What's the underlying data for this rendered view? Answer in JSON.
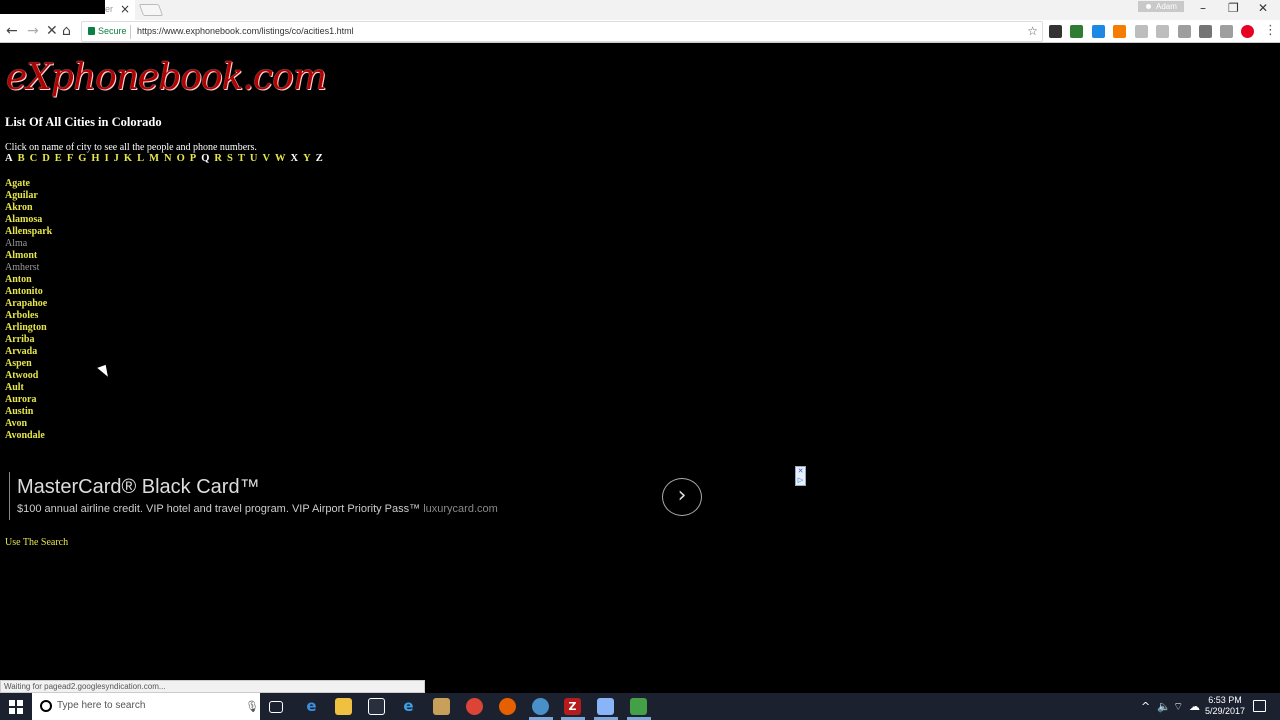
{
  "browser": {
    "tab_title": "er",
    "profile_name": "Adam",
    "secure_label": "Secure",
    "url": "https://www.exphonebook.com/listings/co/acities1.html",
    "status_text": "Waiting for pagead2.googlesyndication.com..."
  },
  "page": {
    "logo": "eXphonebook.com",
    "title": "List Of All Cities in Colorado",
    "instruction": "Click on name of city to see all the people and phone numbers.",
    "letters": [
      "A",
      "B",
      "C",
      "D",
      "E",
      "F",
      "G",
      "H",
      "I",
      "J",
      "K",
      "L",
      "M",
      "N",
      "O",
      "P",
      "Q",
      "R",
      "S",
      "T",
      "U",
      "V",
      "W",
      "X",
      "Y",
      "Z"
    ],
    "current_letter": "A",
    "white_letters": [
      "Q",
      "X",
      "Z"
    ],
    "cities": [
      {
        "name": "Agate",
        "visited": false
      },
      {
        "name": "Aguilar",
        "visited": false
      },
      {
        "name": "Akron",
        "visited": false
      },
      {
        "name": "Alamosa",
        "visited": false
      },
      {
        "name": "Allenspark",
        "visited": false
      },
      {
        "name": "Alma",
        "visited": true
      },
      {
        "name": "Almont",
        "visited": false
      },
      {
        "name": "Amherst",
        "visited": true
      },
      {
        "name": "Anton",
        "visited": false
      },
      {
        "name": "Antonito",
        "visited": false
      },
      {
        "name": "Arapahoe",
        "visited": false
      },
      {
        "name": "Arboles",
        "visited": false
      },
      {
        "name": "Arlington",
        "visited": false
      },
      {
        "name": "Arriba",
        "visited": false
      },
      {
        "name": "Arvada",
        "visited": false
      },
      {
        "name": "Aspen",
        "visited": false
      },
      {
        "name": "Atwood",
        "visited": false
      },
      {
        "name": "Ault",
        "visited": false
      },
      {
        "name": "Aurora",
        "visited": false
      },
      {
        "name": "Austin",
        "visited": false
      },
      {
        "name": "Avon",
        "visited": false
      },
      {
        "name": "Avondale",
        "visited": false
      }
    ],
    "search_link": "Use The Search"
  },
  "ad": {
    "title": "MasterCard® Black Card™",
    "text": "$100 annual airline credit. VIP hotel and travel program. VIP Airport Priority Pass™",
    "url": "luxurycard.com"
  },
  "taskbar": {
    "search_placeholder": "Type here to search",
    "time": "6:53 PM",
    "date": "5/29/2017"
  },
  "colors": {
    "link": "#e6e64c",
    "visited": "#999999",
    "background": "#000000",
    "logo": "#b30000"
  },
  "icons": [
    "back-icon",
    "forward-icon",
    "stop-icon",
    "home-icon",
    "lock-icon",
    "star-icon",
    "windows-start-icon",
    "search-icon",
    "mic-icon",
    "task-view-icon",
    "edge-icon",
    "file-explorer-icon",
    "store-icon",
    "ie-icon",
    "media-icon",
    "chrome-icon",
    "firefox-icon",
    "filezilla-icon",
    "notification-icon"
  ]
}
